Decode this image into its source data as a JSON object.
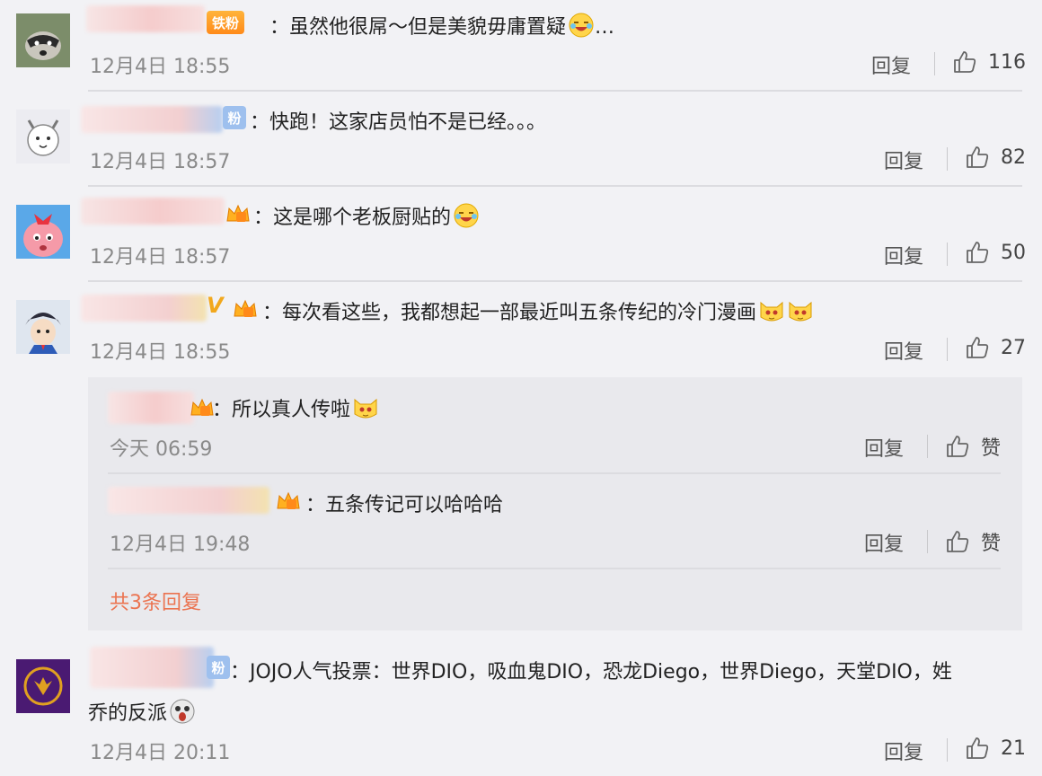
{
  "comments": [
    {
      "badge": "铁粉",
      "text": "虽然他很屌～但是美貌毋庸置疑",
      "suffix": "…",
      "time": "12月4日 18:55",
      "reply": "回复",
      "likes": "116"
    },
    {
      "badge": "粉",
      "text": "快跑！这家店员怕不是已经。。。",
      "time": "12月4日 18:57",
      "reply": "回复",
      "likes": "82"
    },
    {
      "text": "这是哪个老板厨贴的",
      "time": "12月4日 18:57",
      "reply": "回复",
      "likes": "50"
    },
    {
      "vip": "V",
      "text": "每次看这些，我都想起一部最近叫五条传纪的冷门漫画",
      "time": "12月4日 18:55",
      "reply": "回复",
      "likes": "27"
    },
    {
      "badge": "粉",
      "text_line1": "：JOJO人气投票：世界DIO，吸血鬼DIO，恐龙Diego，世界Diego，天堂DIO，姓",
      "text_line2": "乔的反派",
      "time": "12月4日 20:11",
      "reply": "回复",
      "likes": "21"
    }
  ],
  "sub_replies": [
    {
      "text": "所以真人传啦",
      "time": "今天 06:59",
      "reply": "回复",
      "like_label": "赞"
    },
    {
      "text": "五条传记可以哈哈哈",
      "time": "12月4日 19:48",
      "reply": "回复",
      "like_label": "赞"
    }
  ],
  "more_replies": "共3条回复",
  "colors": {
    "accent": "#eb7350",
    "background": "#f2f2f5",
    "subbox": "#e9e9ed"
  }
}
